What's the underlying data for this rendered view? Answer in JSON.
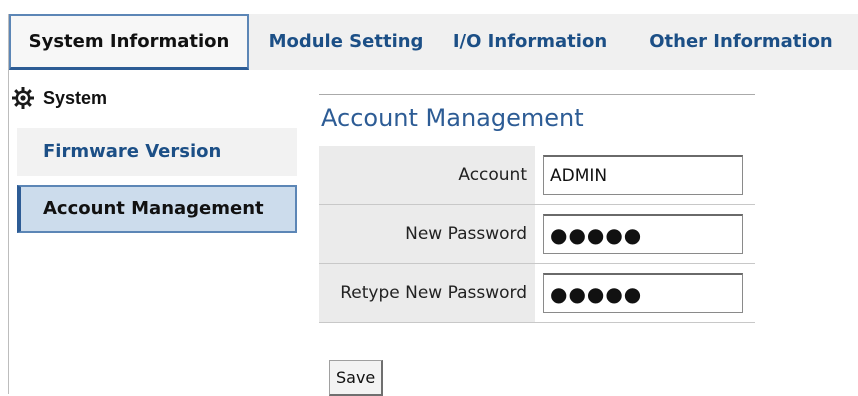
{
  "tabs": [
    {
      "label": "System Information",
      "active": true
    },
    {
      "label": "Module Setting",
      "active": false
    },
    {
      "label": "I/O Information",
      "active": false
    },
    {
      "label": "Other Information",
      "active": false
    }
  ],
  "sidebar": {
    "header": {
      "icon": "gear-icon",
      "title": "System"
    },
    "items": [
      {
        "label": "Firmware Version",
        "selected": false
      },
      {
        "label": "Account Management",
        "selected": true
      }
    ]
  },
  "main": {
    "section_title": "Account Management",
    "fields": [
      {
        "label": "Account",
        "value": "ADMIN",
        "type": "text"
      },
      {
        "label": "New Password",
        "value": "●●●●●",
        "type": "password"
      },
      {
        "label": "Retype New Password",
        "value": "●●●●●",
        "type": "password"
      }
    ],
    "save_label": "Save"
  },
  "colors": {
    "tab_text": "#1c4f86",
    "accent": "#2d5c95",
    "selected_bg": "#ccdcec",
    "label_bg": "#ebebeb"
  }
}
